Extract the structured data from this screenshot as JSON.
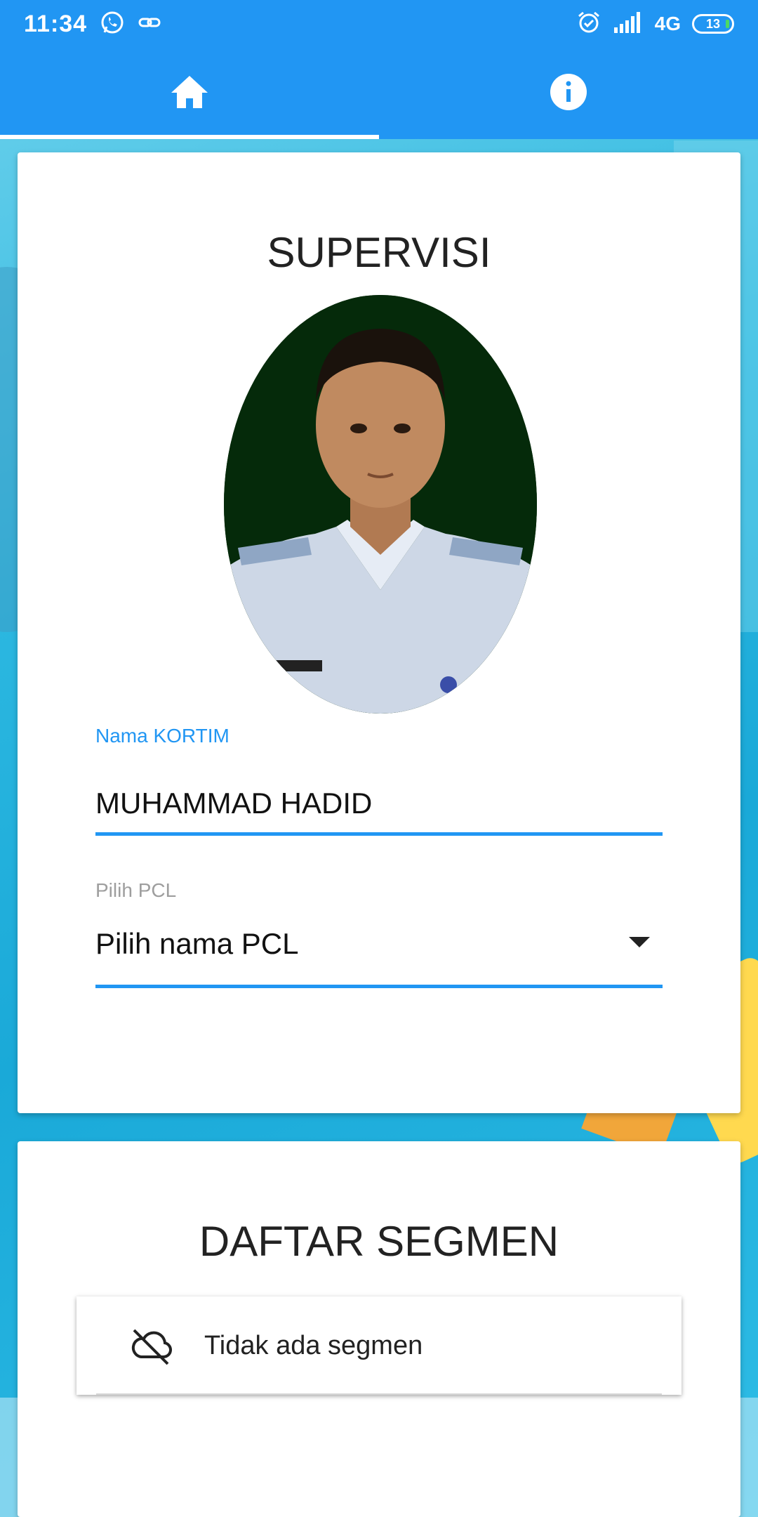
{
  "status_bar": {
    "time": "11:34",
    "network": "4G",
    "battery": "13",
    "icons": [
      "whatsapp-icon",
      "link-icon",
      "alarm-icon",
      "signal-icon",
      "battery-icon"
    ]
  },
  "app_bar": {
    "tabs": [
      {
        "name": "home",
        "icon": "home-icon",
        "active": true
      },
      {
        "name": "info",
        "icon": "info-icon",
        "active": false
      }
    ],
    "color": "#2196f3"
  },
  "supervisi_card": {
    "title": "SUPERVISI",
    "nama_kortim": {
      "label": "Nama KORTIM",
      "value": "MUHAMMAD HADID"
    },
    "pilih_pcl": {
      "label": "Pilih PCL",
      "selected": "Pilih nama PCL"
    }
  },
  "segmen_card": {
    "title": "DAFTAR SEGMEN",
    "empty_icon": "cloud-off-icon",
    "empty_text": "Tidak ada segmen"
  }
}
